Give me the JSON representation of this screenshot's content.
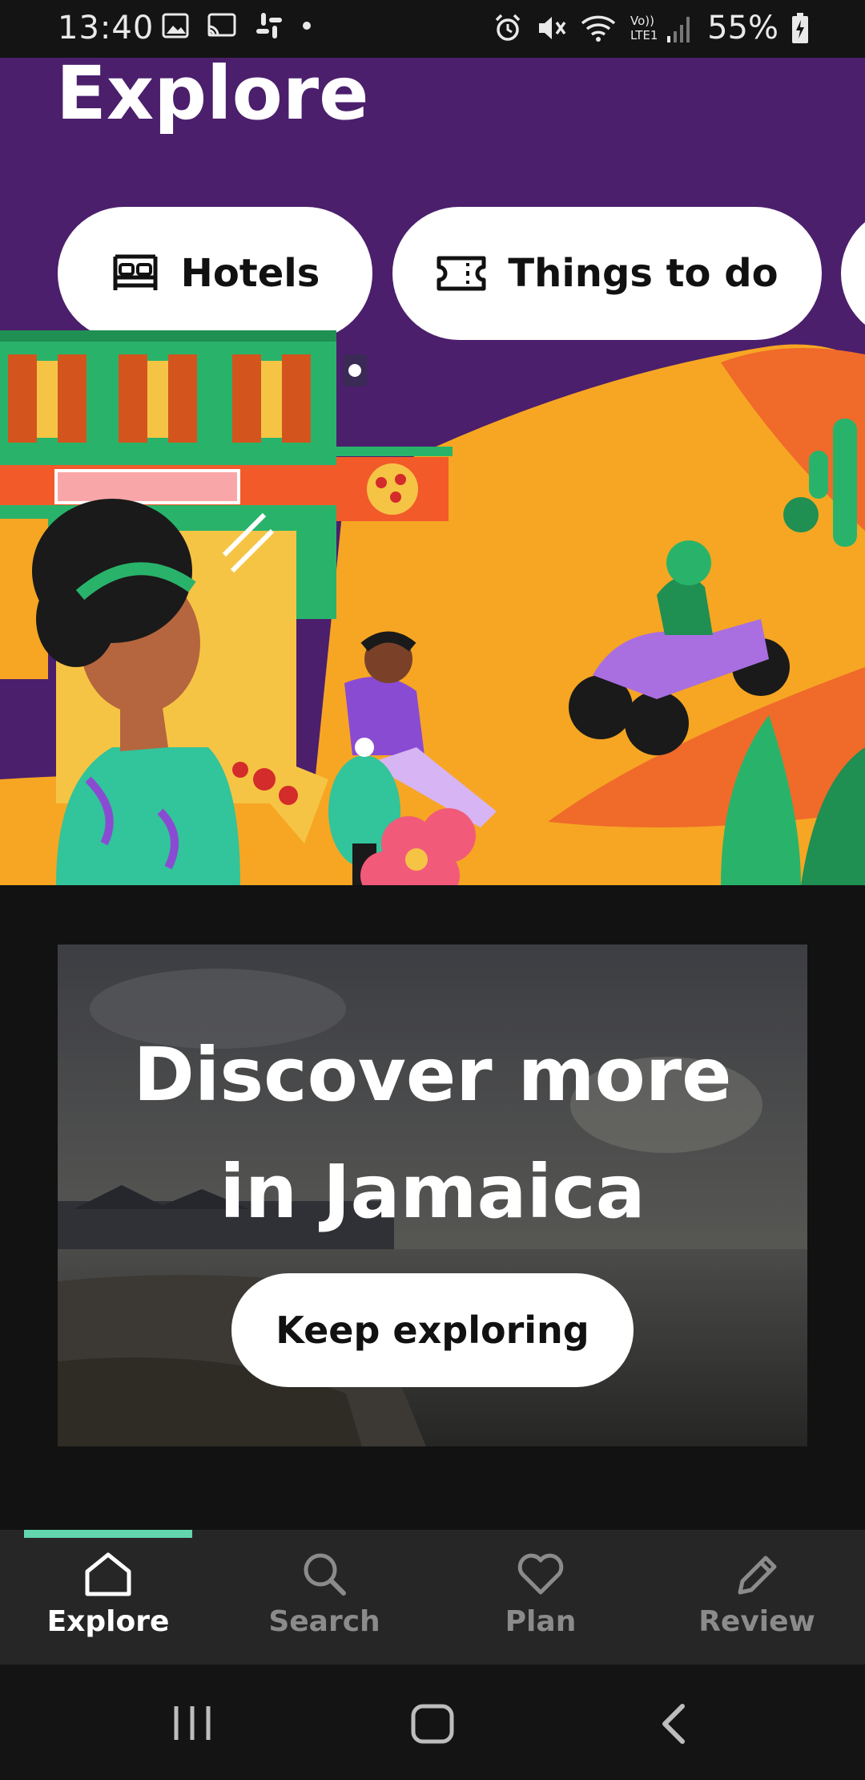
{
  "status_bar": {
    "time": "13:40",
    "left_icons": [
      "image-icon",
      "cast-icon",
      "slack-icon",
      "dot-icon"
    ],
    "right_icons": [
      "alarm-icon",
      "mute-icon",
      "wifi-icon",
      "lte-signal-icon",
      "battery-charging-icon"
    ],
    "lte_label": "Vo))\nLTE1",
    "battery": "55%"
  },
  "hero": {
    "title": "Explore",
    "categories": [
      {
        "label": "Hotels",
        "icon": "bed-icon"
      },
      {
        "label": "Things to do",
        "icon": "ticket-icon"
      }
    ],
    "background_color": "#4b1f6c"
  },
  "discover_card": {
    "title_line1": "Discover more",
    "title_line2": "in Jamaica",
    "button_label": "Keep exploring"
  },
  "bottom_nav": {
    "items": [
      {
        "label": "Explore",
        "icon": "home-icon",
        "active": true
      },
      {
        "label": "Search",
        "icon": "search-icon",
        "active": false
      },
      {
        "label": "Plan",
        "icon": "heart-icon",
        "active": false
      },
      {
        "label": "Review",
        "icon": "pencil-icon",
        "active": false
      }
    ],
    "accent_color": "#63d6ae"
  },
  "system_nav": {
    "buttons": [
      "recents-icon",
      "home-button-icon",
      "back-icon"
    ]
  }
}
